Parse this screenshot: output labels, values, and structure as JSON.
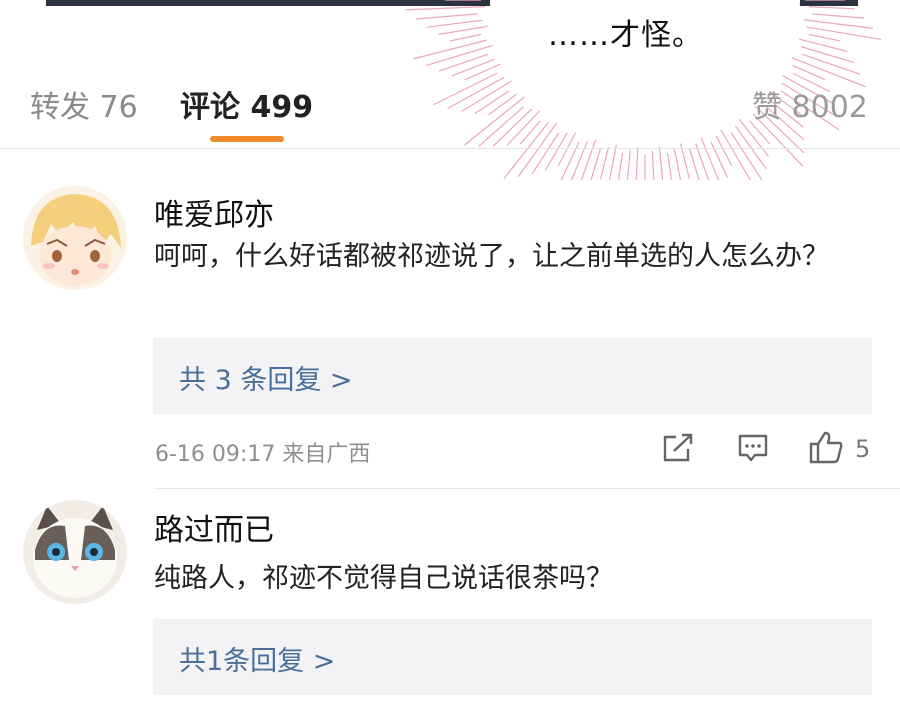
{
  "panel": {
    "bubble_text": "……才怪。"
  },
  "tabs": {
    "forward": "转发 76",
    "comment": "评论 499",
    "like": "赞 8002",
    "active_color": "#f08b2c"
  },
  "comments": [
    {
      "username": "唯爱邱亦",
      "text": "呵呵，什么好话都被祁迹说了，让之前单选的人怎么办？",
      "replies": "共 3 条回复 >",
      "meta": "6-16 09:17  来自广西",
      "likes": "5",
      "avatar": "anime-boy-avatar"
    },
    {
      "username": "路过而已",
      "text": "纯路人，祁迹不觉得自己说话很茶吗？",
      "replies": "共1条回复 >",
      "avatar": "cat-avatar"
    }
  ],
  "icons": {
    "share": "share-icon",
    "comment": "comment-icon",
    "like": "thumbs-up-icon"
  }
}
